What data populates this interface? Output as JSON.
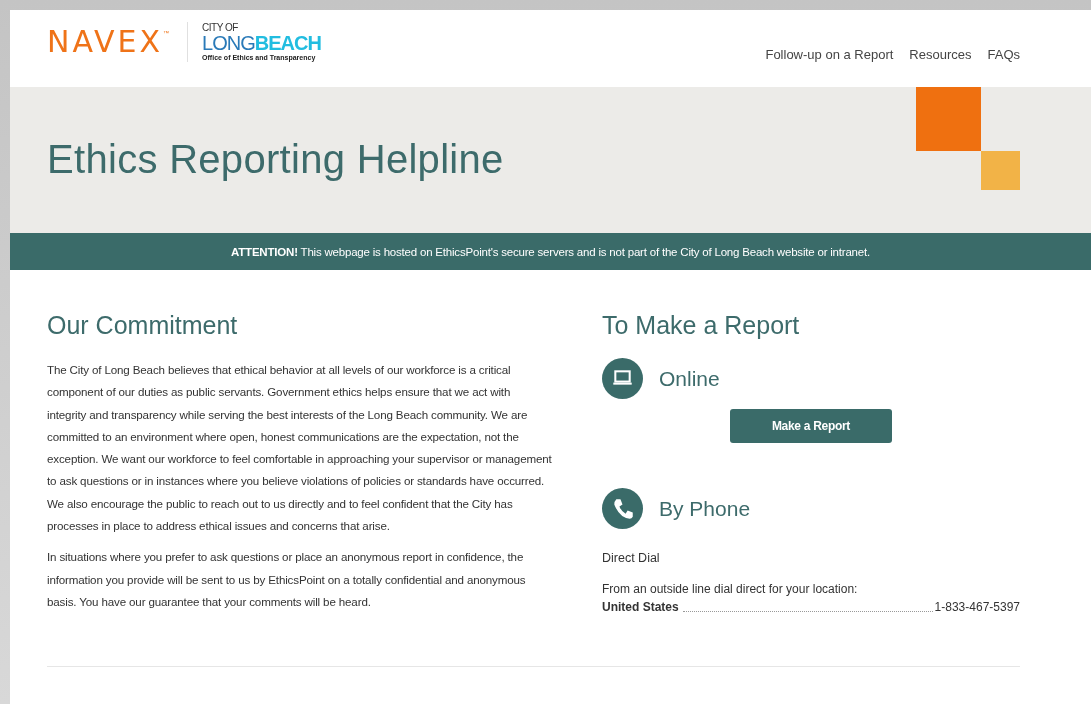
{
  "header": {
    "logo": {
      "brand": "NAVEX",
      "trademark": "™",
      "city_of": "CITY OF",
      "long": "LONG",
      "beach": "BEACH",
      "office": "Office of Ethics and Transparency"
    },
    "nav": [
      {
        "label": "Follow-up on a Report"
      },
      {
        "label": "Resources"
      },
      {
        "label": "FAQs"
      }
    ]
  },
  "hero": {
    "title": "Ethics Reporting Helpline"
  },
  "notice": "**ATTENTION!** This webpage is hosted on EthicsPoint's secure servers and is not part of the City of Long Beach website or intranet.",
  "commitment": {
    "heading": "Our Commitment",
    "paragraphs": [
      "The City of Long Beach believes that ethical behavior at all levels of our workforce is a critical component of our duties as public servants. Government ethics helps ensure that we act with integrity and transparency while serving the best interests of the Long Beach community. We are committed to an environment where open, honest communications are the expectation, not the exception. We want our workforce to feel comfortable in approaching your supervisor or management to ask questions or in instances where you believe violations of policies or standards have occurred. We also encourage the public to reach out to us directly and to feel confident that the City has processes in place to address ethical issues and concerns that arise.",
      "In situations where you prefer to ask questions or place an anonymous report in confidence, the information you provide will be sent to us by EthicsPoint on a totally confidential and anonymous basis. You have our guarantee that your comments will be heard."
    ]
  },
  "report": {
    "heading": "To Make a Report",
    "methods": [
      {
        "kind": "online",
        "title": "Online",
        "button": "Make a Report"
      },
      {
        "kind": "phone",
        "title": "By Phone",
        "subtitle": "Direct Dial",
        "intro": "From an outside line dial direct for your location:",
        "numbers": [
          {
            "country": "United States",
            "number": "1-833-467-5397"
          }
        ]
      }
    ]
  }
}
